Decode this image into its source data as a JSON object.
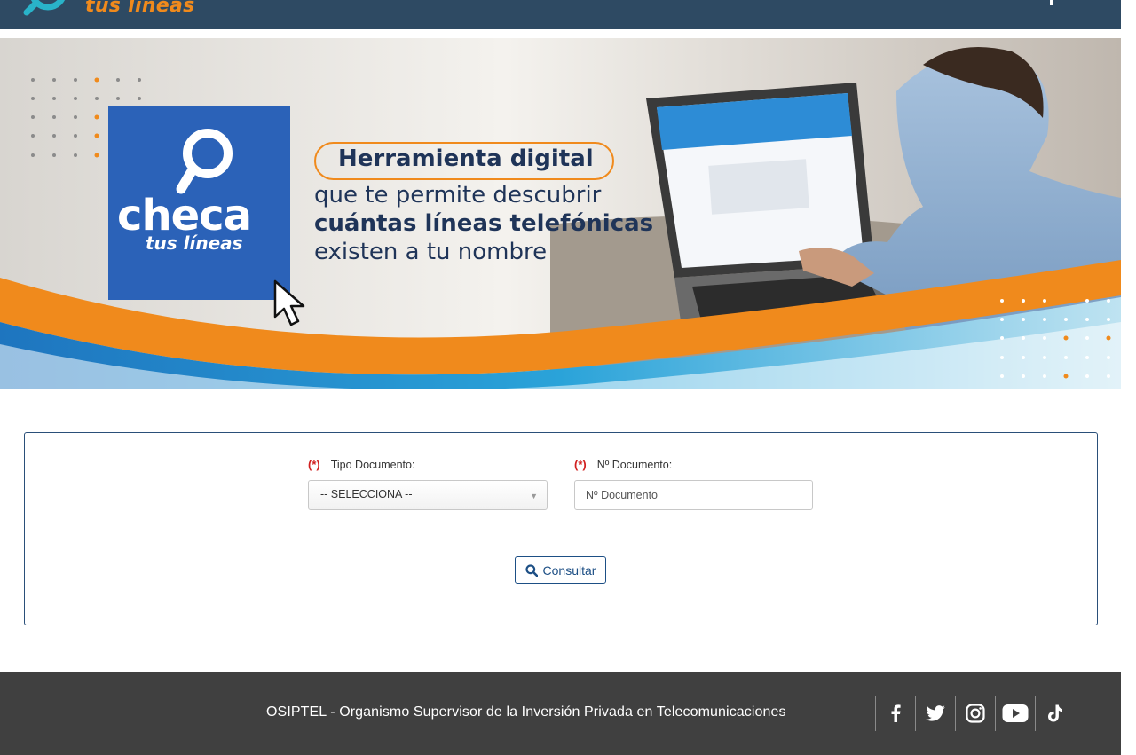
{
  "header": {
    "logo_text": "tus líneas"
  },
  "banner": {
    "brand_title": "checa",
    "brand_subtitle": "tus líneas",
    "headline": "Herramienta digital",
    "tagline_1": "que te permite descubrir",
    "tagline_2": "cuántas líneas telefónicas",
    "tagline_3": "existen a tu nombre"
  },
  "form": {
    "required_mark": "(*)",
    "doc_type_label": "Tipo Documento:",
    "doc_type_selected": "-- SELECCIONA --",
    "doc_number_label": "Nº Documento:",
    "doc_number_placeholder": "Nº Documento",
    "doc_number_value": "",
    "submit_label": "Consultar"
  },
  "footer": {
    "text": "OSIPTEL - Organismo Supervisor de la Inversión Privada en Telecomunicaciones",
    "social": [
      "facebook-icon",
      "twitter-icon",
      "instagram-icon",
      "youtube-icon",
      "tiktok-icon"
    ]
  },
  "colors": {
    "header_bg": "#2e4a63",
    "brand_orange": "#f08a1c",
    "brand_blue": "#2b62b8",
    "form_border": "#2a4f79",
    "required_red": "#d11f1f",
    "footer_bg": "#404040"
  }
}
